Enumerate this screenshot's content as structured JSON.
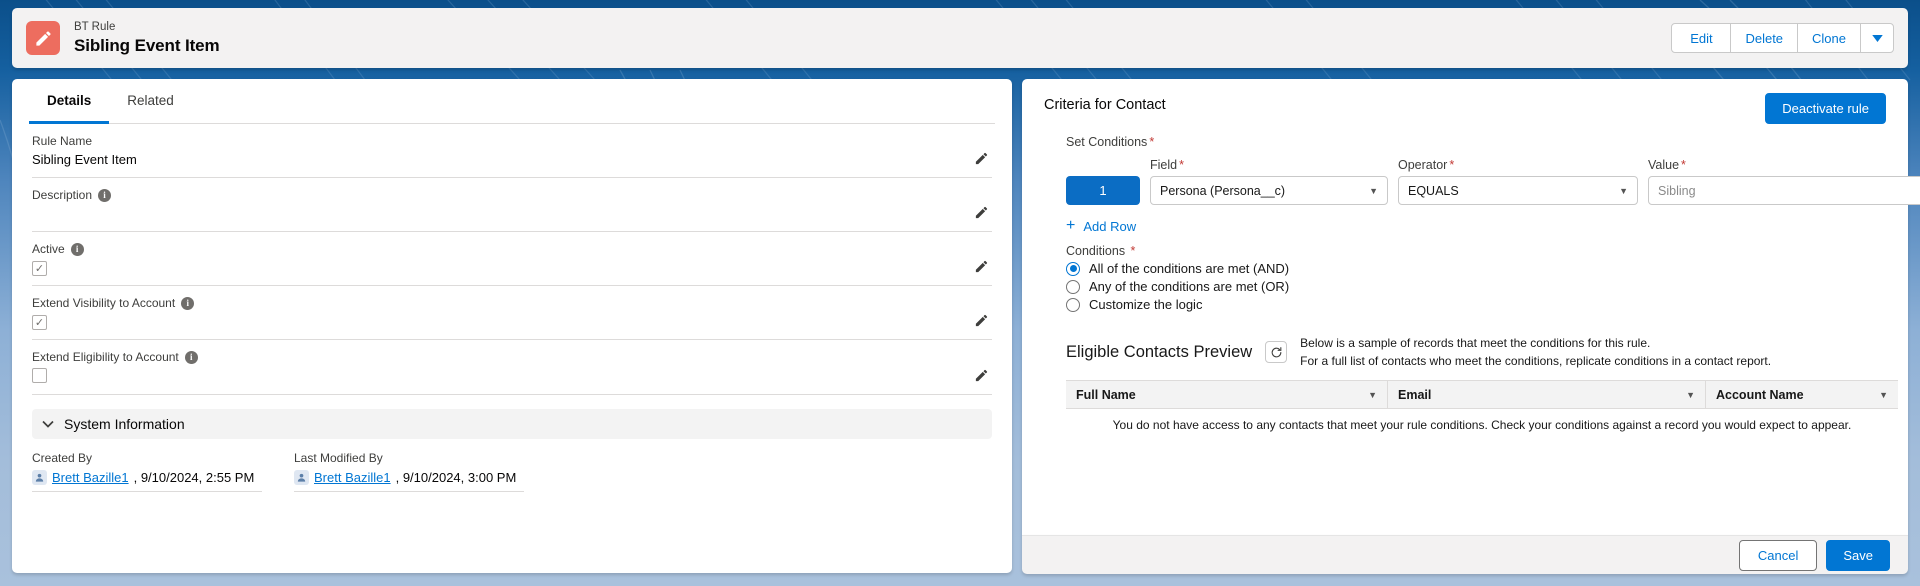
{
  "record_header": {
    "icon": "pencil-record-icon",
    "eyebrow": "BT Rule",
    "title": "Sibling Event Item",
    "actions": [
      {
        "label": "Edit",
        "name": "edit-button"
      },
      {
        "label": "Delete",
        "name": "delete-button"
      },
      {
        "label": "Clone",
        "name": "clone-button"
      }
    ],
    "more_icon": "chevron-down-icon"
  },
  "left_panel": {
    "tabs": [
      {
        "label": "Details",
        "active": true
      },
      {
        "label": "Related",
        "active": false
      }
    ],
    "fields": [
      {
        "label": "Rule Name",
        "value": "Sibling Event Item",
        "type": "text",
        "info": false
      },
      {
        "label": "Description",
        "value": "",
        "type": "text",
        "info": true
      },
      {
        "label": "Active",
        "value": "",
        "type": "checkbox",
        "checked": true,
        "info": true
      },
      {
        "label": "Extend Visibility to Account",
        "value": "",
        "type": "checkbox",
        "checked": true,
        "info": true
      },
      {
        "label": "Extend Eligibility to Account",
        "value": "",
        "type": "checkbox",
        "checked": false,
        "info": true
      }
    ],
    "edit_icon": "pencil-icon",
    "section": {
      "title": "System Information",
      "collapse_icon": "chevron-down-icon",
      "created_by": {
        "label": "Created By",
        "user": "Brett Bazille1",
        "timestamp": ", 9/10/2024, 2:55 PM"
      },
      "last_modified_by": {
        "label": "Last Modified By",
        "user": "Brett Bazille1",
        "timestamp": ", 9/10/2024, 3:00 PM"
      }
    }
  },
  "right_panel": {
    "title": "Criteria for Contact",
    "deactivate_label": "Deactivate rule",
    "set_conditions_label": "Set Conditions",
    "column_labels": {
      "field": "Field",
      "operator": "Operator",
      "value": "Value"
    },
    "condition_rows": [
      {
        "number": "1",
        "field": "Persona (Persona__c)",
        "operator": "EQUALS",
        "value": "Sibling"
      }
    ],
    "add_row_label": "Add Row",
    "conditions_label": "Conditions",
    "condition_options": [
      {
        "label": "All of the conditions are met (AND)",
        "selected": true
      },
      {
        "label": "Any of the conditions are met (OR)",
        "selected": false
      },
      {
        "label": "Customize the logic",
        "selected": false
      }
    ],
    "preview": {
      "title": "Eligible Contacts Preview",
      "refresh_icon": "refresh-icon",
      "desc_line1": "Below is a sample of records that meet the conditions for this rule.",
      "desc_line2": "For a full list of contacts who meet the conditions, replicate conditions in a contact report.",
      "columns": [
        "Full Name",
        "Email",
        "Account Name"
      ],
      "rows": [],
      "empty_message": "You do not have access to any contacts that meet your rule conditions. Check your conditions against a record you would expect to appear."
    },
    "footer": {
      "cancel_label": "Cancel",
      "save_label": "Save"
    }
  },
  "colors": {
    "brand_blue": "#0176d3",
    "record_icon": "#ed6d5f",
    "required_red": "#c23934",
    "row_number_blue": "#0b6dc4"
  }
}
